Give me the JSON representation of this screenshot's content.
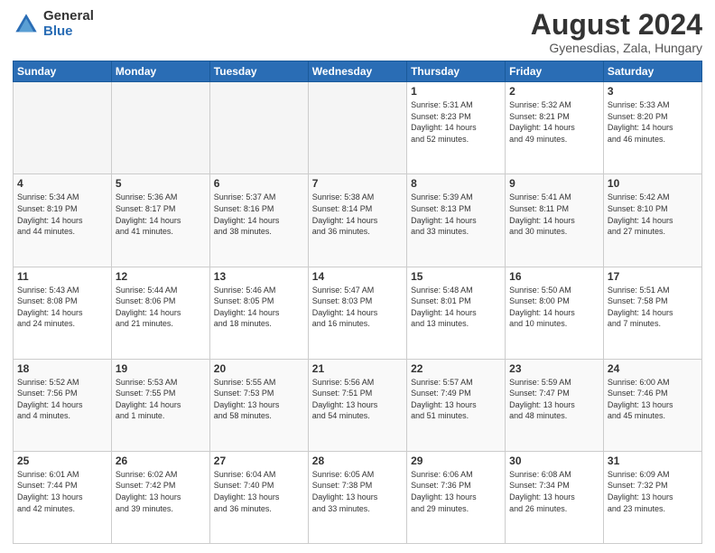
{
  "header": {
    "logo_general": "General",
    "logo_blue": "Blue",
    "month_title": "August 2024",
    "subtitle": "Gyenesdias, Zala, Hungary"
  },
  "days_of_week": [
    "Sunday",
    "Monday",
    "Tuesday",
    "Wednesday",
    "Thursday",
    "Friday",
    "Saturday"
  ],
  "weeks": [
    [
      {
        "day": "",
        "info": ""
      },
      {
        "day": "",
        "info": ""
      },
      {
        "day": "",
        "info": ""
      },
      {
        "day": "",
        "info": ""
      },
      {
        "day": "1",
        "info": "Sunrise: 5:31 AM\nSunset: 8:23 PM\nDaylight: 14 hours\nand 52 minutes."
      },
      {
        "day": "2",
        "info": "Sunrise: 5:32 AM\nSunset: 8:21 PM\nDaylight: 14 hours\nand 49 minutes."
      },
      {
        "day": "3",
        "info": "Sunrise: 5:33 AM\nSunset: 8:20 PM\nDaylight: 14 hours\nand 46 minutes."
      }
    ],
    [
      {
        "day": "4",
        "info": "Sunrise: 5:34 AM\nSunset: 8:19 PM\nDaylight: 14 hours\nand 44 minutes."
      },
      {
        "day": "5",
        "info": "Sunrise: 5:36 AM\nSunset: 8:17 PM\nDaylight: 14 hours\nand 41 minutes."
      },
      {
        "day": "6",
        "info": "Sunrise: 5:37 AM\nSunset: 8:16 PM\nDaylight: 14 hours\nand 38 minutes."
      },
      {
        "day": "7",
        "info": "Sunrise: 5:38 AM\nSunset: 8:14 PM\nDaylight: 14 hours\nand 36 minutes."
      },
      {
        "day": "8",
        "info": "Sunrise: 5:39 AM\nSunset: 8:13 PM\nDaylight: 14 hours\nand 33 minutes."
      },
      {
        "day": "9",
        "info": "Sunrise: 5:41 AM\nSunset: 8:11 PM\nDaylight: 14 hours\nand 30 minutes."
      },
      {
        "day": "10",
        "info": "Sunrise: 5:42 AM\nSunset: 8:10 PM\nDaylight: 14 hours\nand 27 minutes."
      }
    ],
    [
      {
        "day": "11",
        "info": "Sunrise: 5:43 AM\nSunset: 8:08 PM\nDaylight: 14 hours\nand 24 minutes."
      },
      {
        "day": "12",
        "info": "Sunrise: 5:44 AM\nSunset: 8:06 PM\nDaylight: 14 hours\nand 21 minutes."
      },
      {
        "day": "13",
        "info": "Sunrise: 5:46 AM\nSunset: 8:05 PM\nDaylight: 14 hours\nand 18 minutes."
      },
      {
        "day": "14",
        "info": "Sunrise: 5:47 AM\nSunset: 8:03 PM\nDaylight: 14 hours\nand 16 minutes."
      },
      {
        "day": "15",
        "info": "Sunrise: 5:48 AM\nSunset: 8:01 PM\nDaylight: 14 hours\nand 13 minutes."
      },
      {
        "day": "16",
        "info": "Sunrise: 5:50 AM\nSunset: 8:00 PM\nDaylight: 14 hours\nand 10 minutes."
      },
      {
        "day": "17",
        "info": "Sunrise: 5:51 AM\nSunset: 7:58 PM\nDaylight: 14 hours\nand 7 minutes."
      }
    ],
    [
      {
        "day": "18",
        "info": "Sunrise: 5:52 AM\nSunset: 7:56 PM\nDaylight: 14 hours\nand 4 minutes."
      },
      {
        "day": "19",
        "info": "Sunrise: 5:53 AM\nSunset: 7:55 PM\nDaylight: 14 hours\nand 1 minute."
      },
      {
        "day": "20",
        "info": "Sunrise: 5:55 AM\nSunset: 7:53 PM\nDaylight: 13 hours\nand 58 minutes."
      },
      {
        "day": "21",
        "info": "Sunrise: 5:56 AM\nSunset: 7:51 PM\nDaylight: 13 hours\nand 54 minutes."
      },
      {
        "day": "22",
        "info": "Sunrise: 5:57 AM\nSunset: 7:49 PM\nDaylight: 13 hours\nand 51 minutes."
      },
      {
        "day": "23",
        "info": "Sunrise: 5:59 AM\nSunset: 7:47 PM\nDaylight: 13 hours\nand 48 minutes."
      },
      {
        "day": "24",
        "info": "Sunrise: 6:00 AM\nSunset: 7:46 PM\nDaylight: 13 hours\nand 45 minutes."
      }
    ],
    [
      {
        "day": "25",
        "info": "Sunrise: 6:01 AM\nSunset: 7:44 PM\nDaylight: 13 hours\nand 42 minutes."
      },
      {
        "day": "26",
        "info": "Sunrise: 6:02 AM\nSunset: 7:42 PM\nDaylight: 13 hours\nand 39 minutes."
      },
      {
        "day": "27",
        "info": "Sunrise: 6:04 AM\nSunset: 7:40 PM\nDaylight: 13 hours\nand 36 minutes."
      },
      {
        "day": "28",
        "info": "Sunrise: 6:05 AM\nSunset: 7:38 PM\nDaylight: 13 hours\nand 33 minutes."
      },
      {
        "day": "29",
        "info": "Sunrise: 6:06 AM\nSunset: 7:36 PM\nDaylight: 13 hours\nand 29 minutes."
      },
      {
        "day": "30",
        "info": "Sunrise: 6:08 AM\nSunset: 7:34 PM\nDaylight: 13 hours\nand 26 minutes."
      },
      {
        "day": "31",
        "info": "Sunrise: 6:09 AM\nSunset: 7:32 PM\nDaylight: 13 hours\nand 23 minutes."
      }
    ]
  ]
}
